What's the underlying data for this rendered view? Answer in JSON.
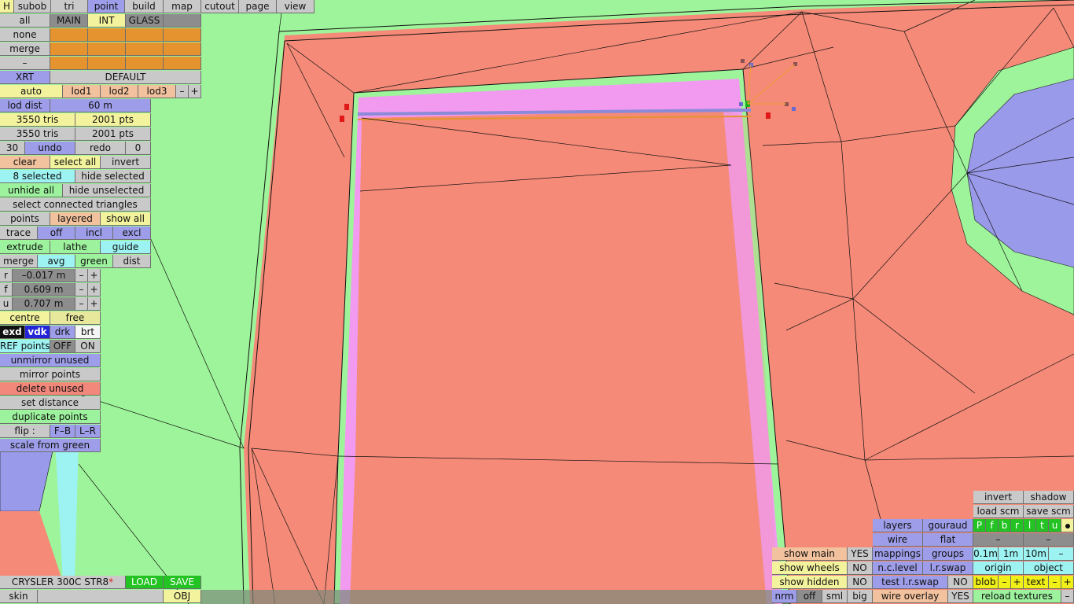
{
  "menu": {
    "h": "H",
    "items": [
      "subob",
      "tri",
      "point",
      "build",
      "map",
      "cutout",
      "page",
      "view"
    ]
  },
  "layer_row": {
    "all": "all",
    "main": "MAIN",
    "int": "INT",
    "glass": "GLASS"
  },
  "none": "none",
  "merge1": "merge",
  "dash": "–",
  "xrt": "XRT",
  "default": "DEFAULT",
  "lod": {
    "auto": "auto",
    "lod1": "lod1",
    "lod2": "lod2",
    "lod3": "lod3",
    "minus": "–",
    "plus": "+"
  },
  "lod_dist": {
    "label": "lod dist",
    "value": "60 m"
  },
  "stats1": {
    "tris": "3550 tris",
    "pts": "2001 pts"
  },
  "stats2": {
    "tris": "3550 tris",
    "pts": "2001 pts"
  },
  "undo_row": {
    "count": "30",
    "undo": "undo",
    "redo": "redo",
    "redo_count": "0"
  },
  "sel_row": {
    "clear": "clear",
    "select_all": "select all",
    "invert": "invert"
  },
  "selected": {
    "count": "8 selected",
    "hide": "hide selected"
  },
  "unhide": {
    "unhide_all": "unhide all",
    "hide_unselected": "hide unselected"
  },
  "select_connected": "select connected triangles",
  "points_row": {
    "points": "points",
    "layered": "layered",
    "show_all": "show all"
  },
  "trace_row": {
    "trace": "trace",
    "off": "off",
    "incl": "incl",
    "excl": "excl"
  },
  "extrude_row": {
    "extrude": "extrude",
    "lathe": "lathe",
    "guide": "guide"
  },
  "merge_row": {
    "merge": "merge",
    "avg": "avg",
    "green": "green",
    "dist": "dist"
  },
  "coords": [
    {
      "axis": "r",
      "value": "–0.017 m",
      "minus": "–",
      "plus": "+"
    },
    {
      "axis": "f",
      "value": "0.609 m",
      "minus": "–",
      "plus": "+"
    },
    {
      "axis": "u",
      "value": "0.707 m",
      "minus": "–",
      "plus": "+"
    }
  ],
  "centre_row": {
    "centre": "centre",
    "free": "free"
  },
  "shade_row": {
    "exd": "exd",
    "vdk": "vdk",
    "drk": "drk",
    "brt": "brt"
  },
  "ref_row": {
    "label": "REF points",
    "off": "OFF",
    "on": "ON"
  },
  "unmirror": "unmirror unused",
  "mirror": "mirror points",
  "delete_unused": "delete unused",
  "set_distance": "set distance",
  "duplicate": "duplicate points",
  "flip_row": {
    "label": "flip :",
    "fb": "F–B",
    "lr": "L–R"
  },
  "scale_green": "scale from green",
  "bottom_left": {
    "name": "CRYSLER 300C STR8",
    "star": "*",
    "load": "LOAD",
    "save": "SAVE",
    "skin": "skin",
    "obj": "OBJ"
  },
  "bottom_right": {
    "invert": "invert",
    "shadow": "shadow",
    "load_scm": "load scm",
    "save_scm": "save scm",
    "view_letters": [
      "P",
      "f",
      "b",
      "r",
      "l",
      "t",
      "u"
    ],
    "layers": "layers",
    "gouraud": "gouraud",
    "wire": "wire",
    "flat": "flat",
    "dash": "–",
    "show_main": "show main",
    "yes1": "YES",
    "mappings": "mappings",
    "groups": "groups",
    "d01": "0.1m",
    "d1": "1m",
    "d10": "10m",
    "show_wheels": "show wheels",
    "no1": "NO",
    "nc_level": "n.c.level",
    "lr_swap": "l.r.swap",
    "origin": "origin",
    "object": "object",
    "show_hidden": "show hidden",
    "no2": "NO",
    "test_lr_swap": "test l.r.swap",
    "no3": "NO",
    "blob": "blob",
    "text": "text",
    "minus": "–",
    "plus": "+",
    "nrm": "nrm",
    "off": "off",
    "sml": "sml",
    "big": "big",
    "wire_overlay": "wire overlay",
    "yes2": "YES",
    "reload_textures": "reload textures"
  },
  "colors": {
    "ground": "#9ef49a",
    "body": "#f58a78",
    "trim": "#f29af0",
    "wheel": "#9a9aea"
  }
}
